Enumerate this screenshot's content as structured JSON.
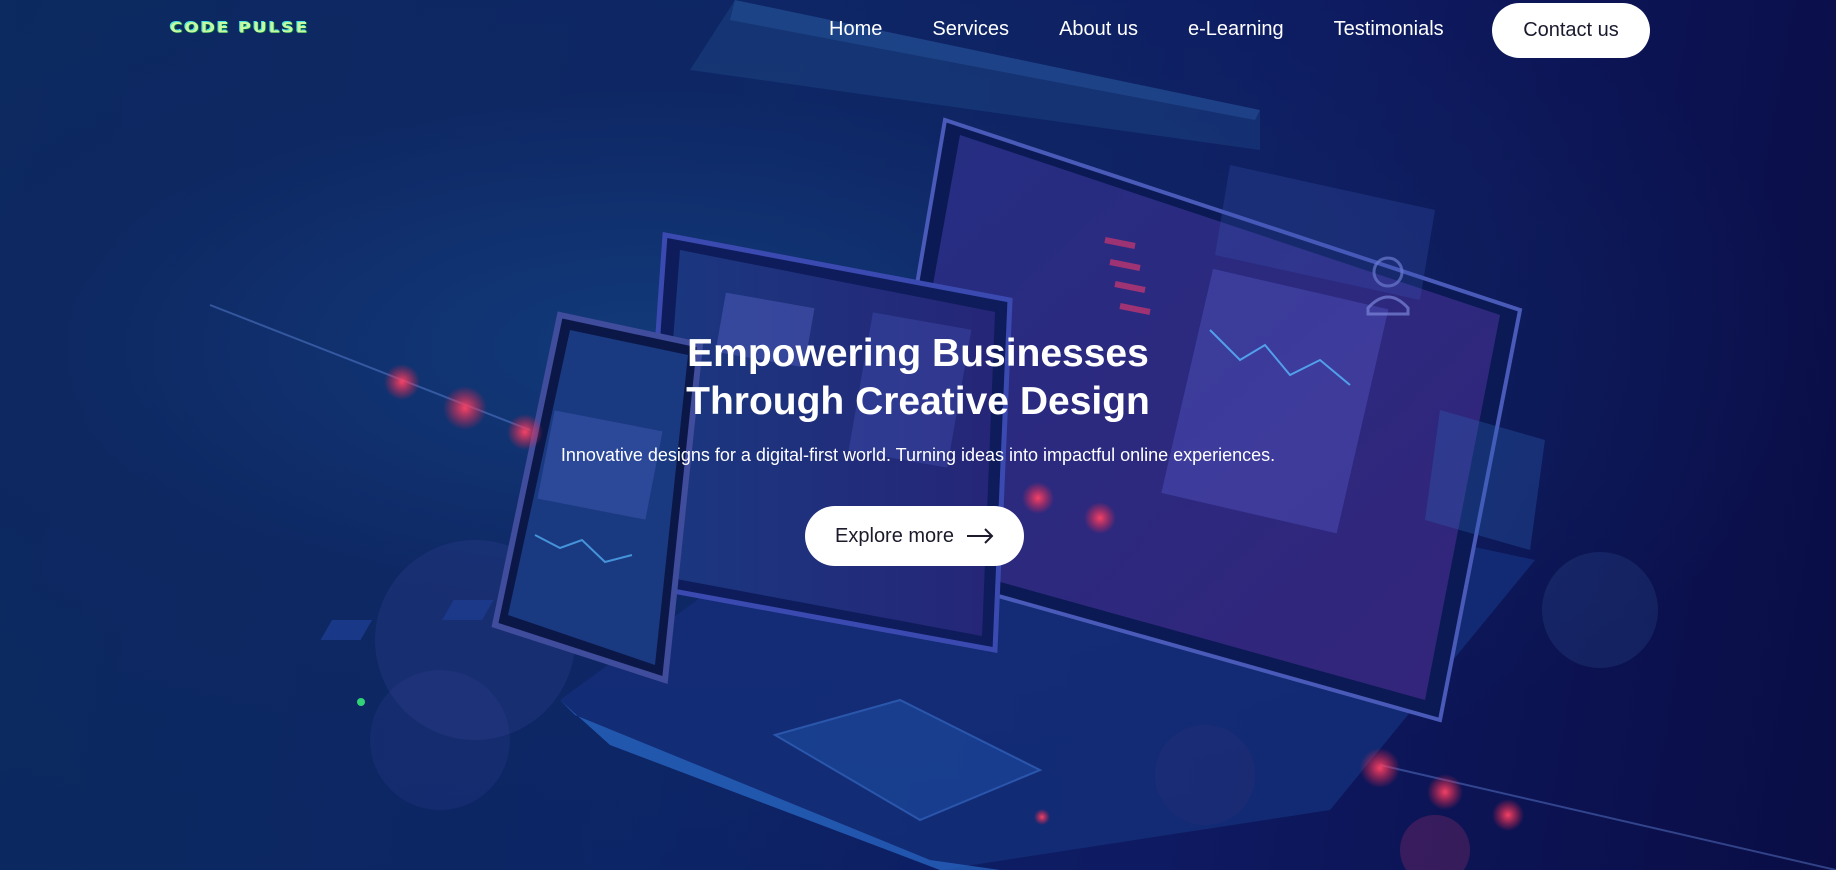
{
  "brand": {
    "logo_text": "CODE PULSE"
  },
  "nav": {
    "items": [
      {
        "label": "Home"
      },
      {
        "label": "Services"
      },
      {
        "label": "About us"
      },
      {
        "label": "e-Learning"
      },
      {
        "label": "Testimonials"
      }
    ],
    "contact_label": "Contact us"
  },
  "hero": {
    "title_line1": "Empowering Businesses",
    "title_line2": "Through Creative Design",
    "subtitle": "Innovative designs for a digital-first world. Turning ideas into impactful online experiences.",
    "cta_label": "Explore more",
    "cta_icon": "arrow-right-icon"
  },
  "colors": {
    "background": "#0a1846",
    "accent_glow": "#ff3b5c",
    "button_bg": "#ffffff",
    "text": "#ffffff"
  }
}
